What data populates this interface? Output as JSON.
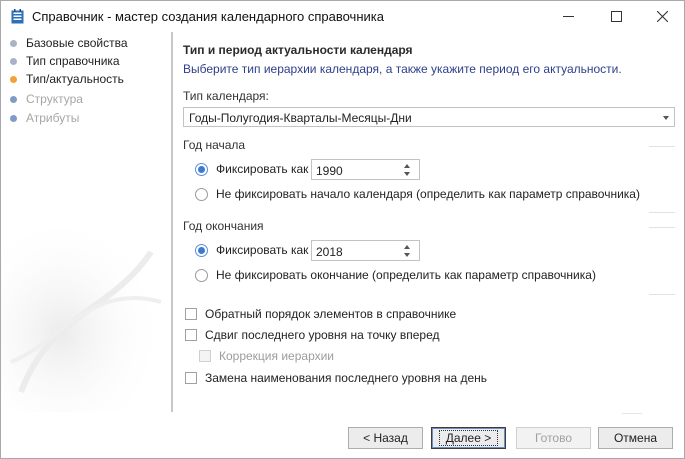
{
  "window": {
    "title": "Справочник - мастер создания календарного справочника",
    "minimize_icon": "minimize-icon",
    "maximize_icon": "maximize-icon",
    "close_icon": "close-icon"
  },
  "nav": {
    "items": [
      {
        "label": "Базовые свойства",
        "state": "done"
      },
      {
        "label": "Тип справочника",
        "state": "done"
      },
      {
        "label": "Тип/актуальность",
        "state": "current"
      },
      {
        "label": "Структура",
        "state": "pending"
      },
      {
        "label": "Атрибуты",
        "state": "pending"
      }
    ]
  },
  "page": {
    "title": "Тип и период актуальности календаря",
    "subtitle": "Выберите тип иерархии календаря, а также укажите период его актуальности.",
    "calendar_type": {
      "label": "Тип календаря:",
      "value": "Годы-Полугодия-Кварталы-Месяцы-Дни"
    },
    "start_year": {
      "group_title": "Год начала",
      "fix_label": "Фиксировать как",
      "fix_selected": true,
      "value": "1990",
      "param_label": "Не фиксировать начало календаря (определить как параметр справочника)"
    },
    "end_year": {
      "group_title": "Год окончания",
      "fix_label": "Фиксировать как",
      "fix_selected": true,
      "value": "2018",
      "param_label": "Не фиксировать окончание (определить как параметр справочника)"
    },
    "options": {
      "reverse_order": {
        "label": "Обратный порядок элементов в справочнике",
        "checked": false
      },
      "shift_last_level": {
        "label": "Сдвиг последнего уровня на точку вперед",
        "checked": false
      },
      "hierarchy_correction": {
        "label": "Коррекция иерархии",
        "checked": false,
        "disabled": true
      },
      "rename_last_level": {
        "label": "Замена наименования последнего уровня на день",
        "checked": false
      }
    }
  },
  "footer": {
    "back_label": "< Назад",
    "next_label": "Далее >",
    "done_label": "Готово",
    "cancel_label": "Отмена"
  },
  "colors": {
    "accent": "#3d7ad3",
    "current_step": "#f0a13a",
    "subtitle_text": "#2e3f8a"
  }
}
